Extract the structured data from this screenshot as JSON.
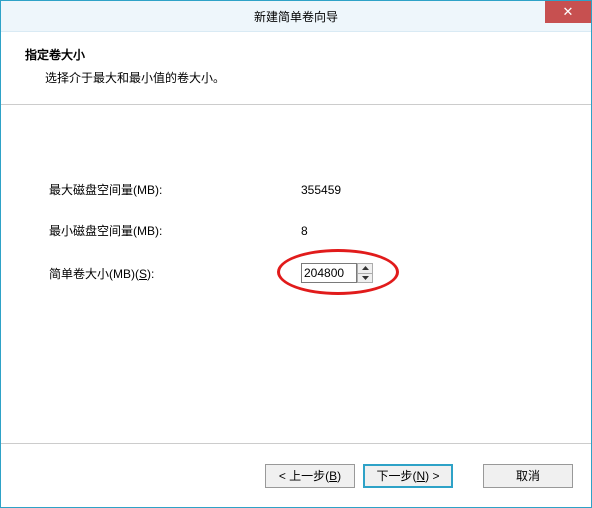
{
  "titlebar": {
    "title": "新建简单卷向导",
    "close_glyph": "✕"
  },
  "header": {
    "main": "指定卷大小",
    "sub": "选择介于最大和最小值的卷大小。"
  },
  "fields": {
    "max_label": "最大磁盘空间量(MB):",
    "max_value": "355459",
    "min_label": "最小磁盘空间量(MB):",
    "min_value": "8",
    "size_label_pre": "简单卷大小(MB)(",
    "size_label_hotkey": "S",
    "size_label_post": "):",
    "size_value": "204800"
  },
  "footer": {
    "back_pre": "< 上一步(",
    "back_hotkey": "B",
    "back_post": ")",
    "next_pre": "下一步(",
    "next_hotkey": "N",
    "next_post": ") >",
    "cancel": "取消"
  }
}
